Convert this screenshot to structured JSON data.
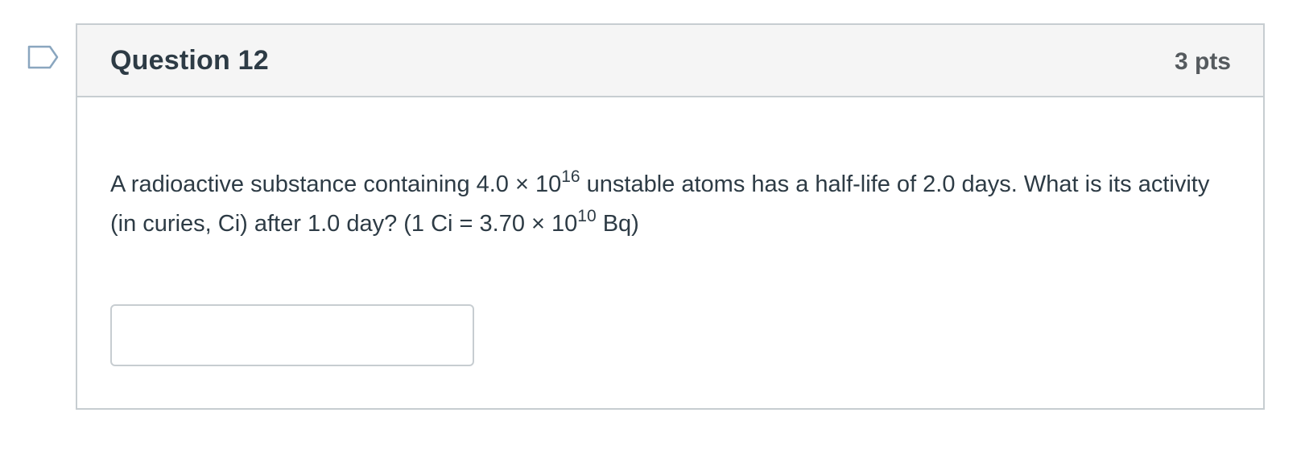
{
  "flag": {
    "icon": "bookmark-flag-icon"
  },
  "question": {
    "title": "Question 12",
    "points": "3 pts",
    "text": {
      "part1": "A radioactive substance containing 4.0 × 10",
      "exp1": "16",
      "part2": " unstable atoms has a half-life of 2.0 days. What is its activity (in curies, Ci) after 1.0 day? (1 Ci = 3.70 × 10",
      "exp2": "10",
      "part3": " Bq)"
    },
    "answer": {
      "value": "",
      "placeholder": ""
    }
  },
  "colors": {
    "border": "#c7cdd1",
    "header_bg": "#f5f5f5",
    "text": "#2d3b45",
    "points_text": "#555a5e",
    "flag_stroke": "#8aa6bf"
  }
}
